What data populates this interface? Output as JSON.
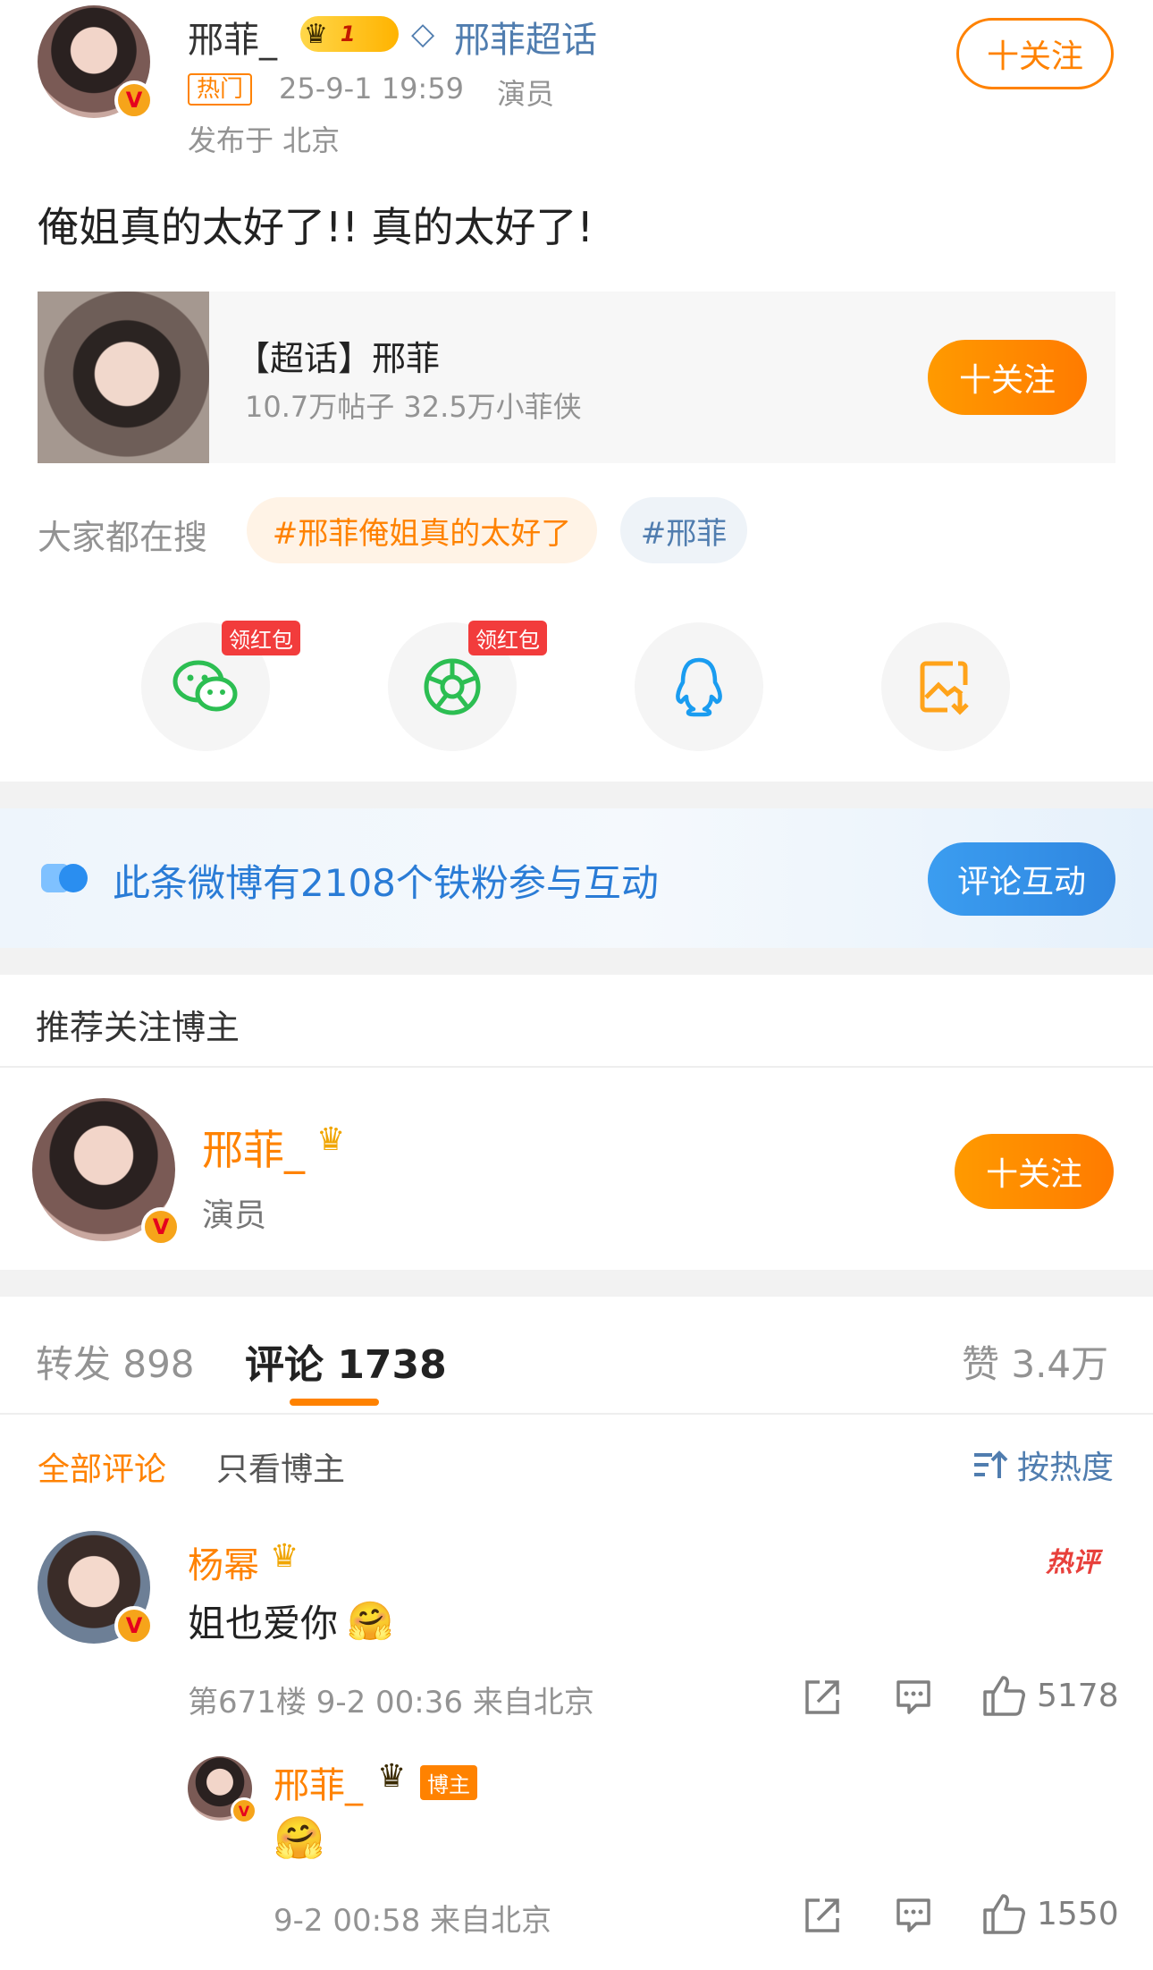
{
  "post": {
    "author": "邢菲_",
    "supertopic_link": "邢菲超话",
    "level_badge": "1",
    "hot_tag": "热门",
    "timestamp": "25-9-1 19:59",
    "role": "演员",
    "location": "发布于 北京",
    "follow_label": "十关注",
    "content": "俺姐真的太好了!! 真的太好了!"
  },
  "supertopic_card": {
    "title": "【超话】邢菲",
    "stats": "10.7万帖子 32.5万小菲侠",
    "follow_label": "十关注"
  },
  "search": {
    "label": "大家都在搜",
    "tags": [
      "#邢菲俺姐真的太好了",
      "#邢菲"
    ]
  },
  "share": {
    "redpack_label": "领红包",
    "items": [
      "wechat-icon",
      "moments-icon",
      "qq-icon",
      "save-image-icon"
    ]
  },
  "banner": {
    "text": "此条微博有2108个铁粉参与互动",
    "button": "评论互动"
  },
  "recommend": {
    "title": "推荐关注博主",
    "name": "邢菲_",
    "role": "演员",
    "follow_label": "十关注"
  },
  "tabs": {
    "repost": "转发 898",
    "comments": "评论 1738",
    "likes": "赞 3.4万"
  },
  "filters": {
    "all": "全部评论",
    "author_only": "只看博主",
    "sort": "按热度"
  },
  "comments": [
    {
      "name": "杨幂",
      "hot_badge": "热评",
      "text": "姐也爱你",
      "emoji": "🤗",
      "meta": "第671楼 9-2 00:36 来自北京",
      "likes": "5178"
    }
  ],
  "reply": {
    "name": "邢菲_",
    "author_badge": "博主",
    "emoji": "🤗",
    "meta": "9-2 00:58 来自北京",
    "likes": "1550"
  },
  "colors": {
    "orange": "#ff8200",
    "link_blue": "#507daf",
    "gray": "#939393"
  }
}
